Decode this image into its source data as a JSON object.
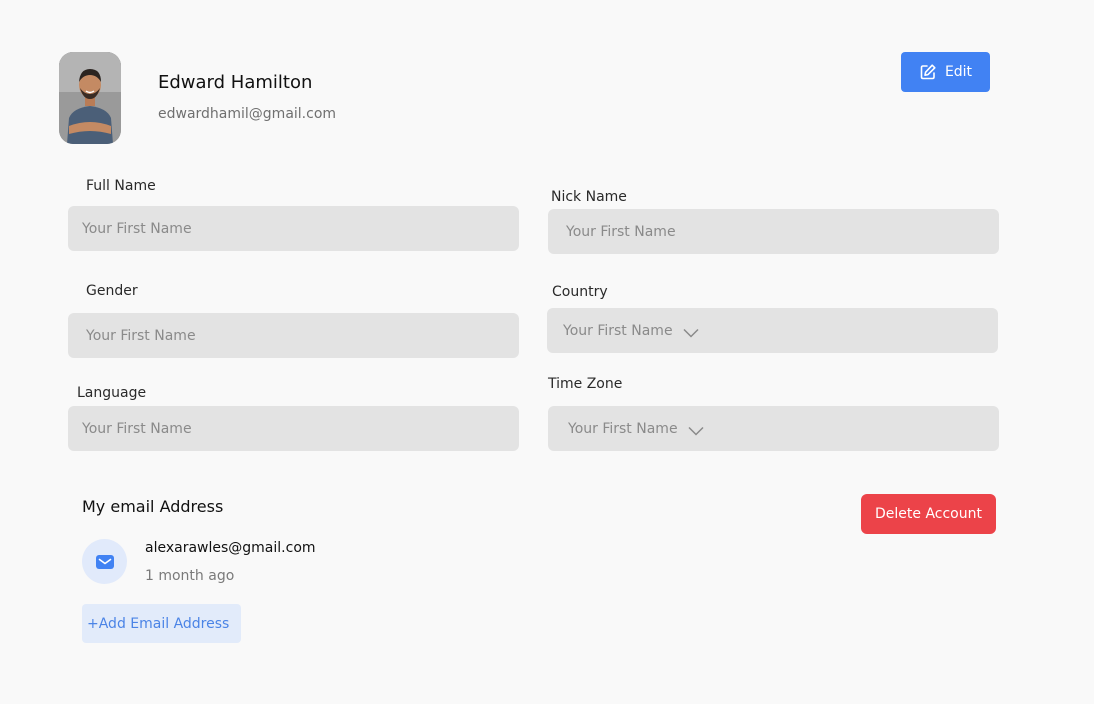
{
  "profile": {
    "name": "Edward Hamilton",
    "email": "edwardhamil@gmail.com",
    "avatar_icon": "user-photo"
  },
  "actions": {
    "edit_label": "Edit",
    "edit_icon": "edit-pencil-icon",
    "delete_label": "Delete Account"
  },
  "form": {
    "full_name": {
      "label": "Full Name",
      "placeholder": "Your First Name"
    },
    "nick_name": {
      "label": "Nick Name",
      "placeholder": "Your First Name"
    },
    "gender": {
      "label": "Gender",
      "placeholder": "Your First Name"
    },
    "country": {
      "label": "Country",
      "placeholder": "Your First Name",
      "icon": "chevron-down-icon"
    },
    "language": {
      "label": "Language",
      "placeholder": "Your First Name"
    },
    "time_zone": {
      "label": "Time Zone",
      "placeholder": "Your First Name",
      "icon": "chevron-down-icon"
    }
  },
  "email_section": {
    "title": "My email Address",
    "entries": [
      {
        "address": "alexarawles@gmail.com",
        "time": "1 month ago",
        "icon": "mail-icon"
      }
    ],
    "add_label": "+Add Email Address"
  },
  "colors": {
    "background": "#f9f9f9",
    "field": "#e3e3e3",
    "primary": "#4182f3",
    "danger": "#ec4349",
    "soft_blue": "#e2ebfa"
  }
}
